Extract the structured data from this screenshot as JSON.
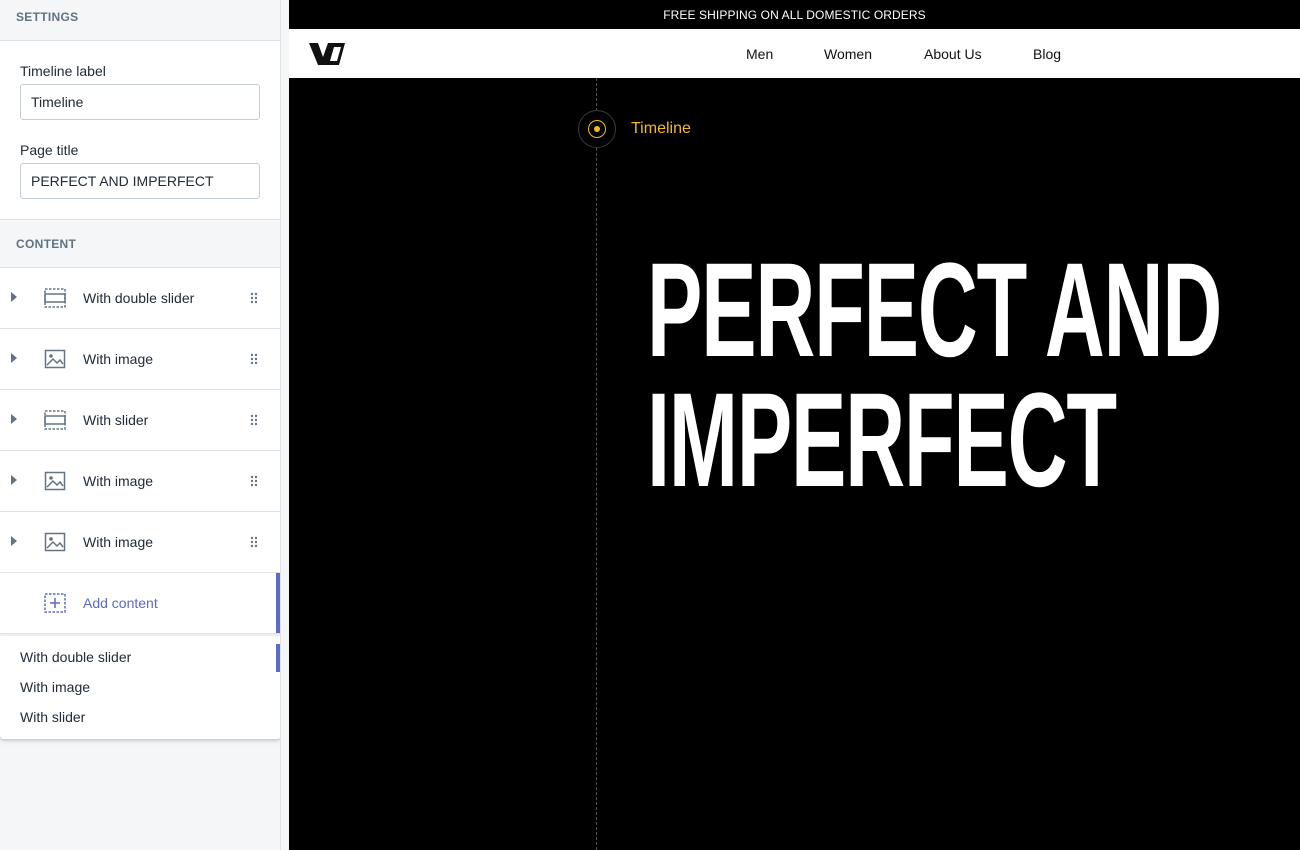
{
  "sidebar": {
    "settings_heading": "SETTINGS",
    "timeline_label": {
      "label": "Timeline label",
      "value": "Timeline"
    },
    "page_title": {
      "label": "Page title",
      "value": "PERFECT AND IMPERFECT"
    },
    "content_heading": "CONTENT",
    "items": [
      {
        "label": "With double slider",
        "icon": "slider-icon"
      },
      {
        "label": "With image",
        "icon": "image-icon"
      },
      {
        "label": "With slider",
        "icon": "slider-icon"
      },
      {
        "label": "With image",
        "icon": "image-icon"
      },
      {
        "label": "With image",
        "icon": "image-icon"
      }
    ],
    "add_content": {
      "label": "Add content",
      "icon": "add-icon"
    },
    "dropdown_options": [
      "With double slider",
      "With image",
      "With slider"
    ]
  },
  "preview": {
    "announcement": "FREE SHIPPING ON ALL DOMESTIC ORDERS",
    "nav": [
      "Men",
      "Women",
      "About Us",
      "Blog"
    ],
    "timeline_label": "Timeline",
    "hero_line1": "PERFECT AND",
    "hero_line2": "IMPERFECT"
  },
  "colors": {
    "accent": "#5c6ac4",
    "timeline": "#f5b921",
    "preview_bg": "#000000"
  }
}
